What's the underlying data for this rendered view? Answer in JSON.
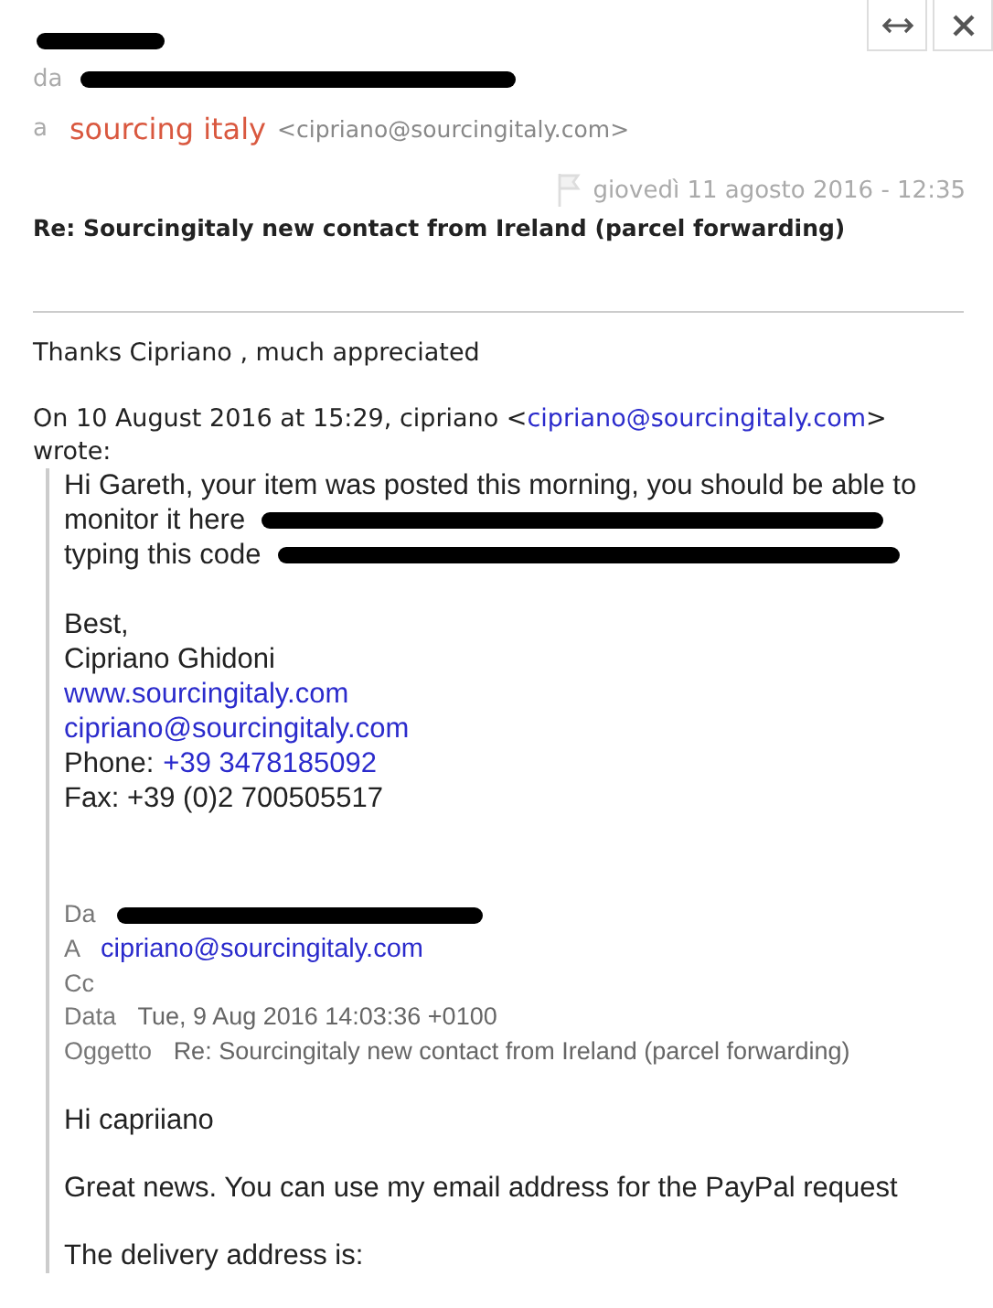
{
  "header": {
    "from_label": "da",
    "to_label": "a",
    "to_name": "sourcing italy",
    "to_address": "<cipriano@sourcingitaly.com>",
    "date": "giovedì 11 agosto 2016 - 12:35",
    "subject": "Re: Sourcingitaly new contact from Ireland (parcel forwarding)"
  },
  "reply": {
    "text": "Thanks Cipriano , much appreciated"
  },
  "attribution": {
    "before": "On 10 August 2016 at 15:29, cipriano <",
    "link": "cipriano@sourcingitaly.com",
    "after": "> wrote:"
  },
  "quote": {
    "paragraphs": [
      {
        "lines": [
          [
            {
              "kind": "text",
              "text": "Hi Gareth, your item was posted this morning, you should be able to"
            }
          ],
          [
            {
              "kind": "text",
              "text": "monitor it here"
            },
            {
              "kind": "redacted"
            }
          ],
          [
            {
              "kind": "text",
              "text": "typing this code"
            },
            {
              "kind": "redacted"
            }
          ]
        ]
      },
      {
        "lines": [
          [
            {
              "kind": "text",
              "text": "Best,"
            }
          ],
          [
            {
              "kind": "text",
              "text": "Cipriano Ghidoni"
            }
          ],
          [
            {
              "kind": "link",
              "text": "www.sourcingitaly.com"
            }
          ],
          [
            {
              "kind": "link",
              "text": "cipriano@sourcingitaly.com"
            }
          ],
          [
            {
              "kind": "text",
              "text": "Phone:"
            },
            {
              "kind": "link",
              "text": "+39 3478185092"
            }
          ],
          [
            {
              "kind": "text",
              "text": "Fax: +39 (0)2 700505517"
            }
          ]
        ]
      }
    ],
    "forwarded_headers": [
      {
        "label": "Da",
        "values": [
          {
            "kind": "redacted"
          }
        ]
      },
      {
        "label": "A",
        "values": [
          {
            "kind": "link",
            "text": "cipriano@sourcingitaly.com"
          }
        ]
      },
      {
        "label": "Cc"
      },
      {
        "label": "Data",
        "values": [
          {
            "kind": "text",
            "text": "Tue, 9 Aug 2016 14:03:36 +0100"
          }
        ]
      },
      {
        "label": "Oggetto",
        "values": [
          {
            "kind": "text",
            "text": "Re: Sourcingitaly new contact from Ireland (parcel forwarding)"
          }
        ]
      }
    ],
    "forwarded_paragraphs": [
      "Hi capriiano",
      "Great news. You can use my email address for the PayPal request",
      "The delivery address is:"
    ]
  }
}
